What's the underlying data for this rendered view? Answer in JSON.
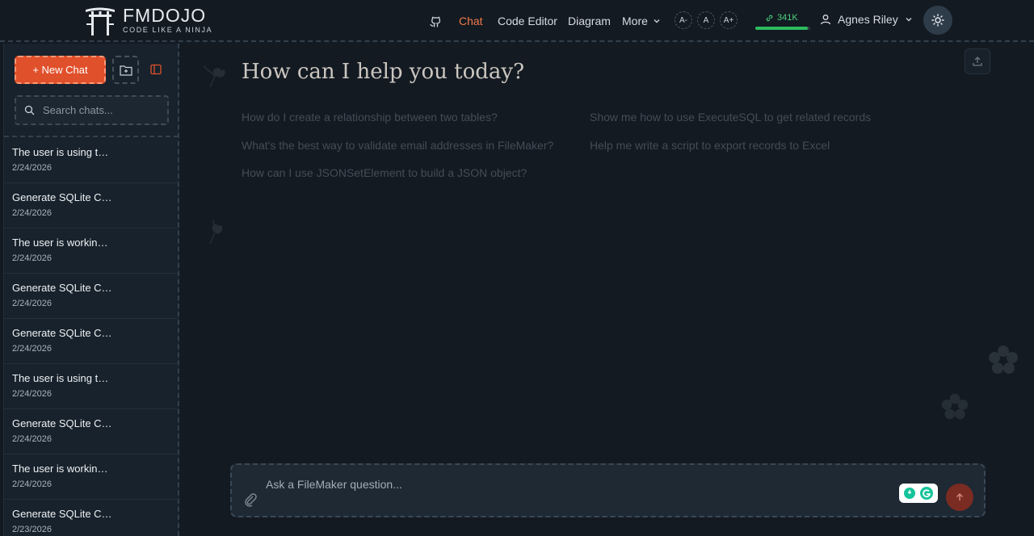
{
  "header": {
    "logo": {
      "name": "FMDOJO",
      "tagline": "CODE LIKE A NINJA",
      "icon": "torii-gate-icon"
    },
    "nav": [
      {
        "label": "Chat",
        "active": true
      },
      {
        "label": "Code Editor",
        "active": false
      },
      {
        "label": "Diagram",
        "active": false
      },
      {
        "label": "More",
        "active": false
      }
    ],
    "font_controls": [
      "A-",
      "A",
      "A+"
    ],
    "tokens": {
      "label": "341K",
      "fill_fraction": 0.95,
      "color": "#2dbb5d"
    },
    "user": {
      "name": "Agnes Riley"
    },
    "icons": {
      "github": "github-icon",
      "theme": "sun-icon"
    }
  },
  "sidebar": {
    "new_chat_label": "+ New Chat",
    "search_placeholder": "Search chats...",
    "chats": [
      {
        "title": "The user is using t…",
        "date": "2/24/2026"
      },
      {
        "title": "Generate SQLite C…",
        "date": "2/24/2026"
      },
      {
        "title": "The user is workin…",
        "date": "2/24/2026"
      },
      {
        "title": "Generate SQLite C…",
        "date": "2/24/2026"
      },
      {
        "title": "Generate SQLite C…",
        "date": "2/24/2026"
      },
      {
        "title": "The user is using t…",
        "date": "2/24/2026"
      },
      {
        "title": "Generate SQLite C…",
        "date": "2/24/2026"
      },
      {
        "title": "The user is workin…",
        "date": "2/24/2026"
      },
      {
        "title": "Generate SQLite C…",
        "date": "2/23/2026"
      }
    ]
  },
  "main": {
    "heading": "How can I help you today?",
    "suggestions": [
      "How do I create a relationship between two tables?",
      "Show me how to use ExecuteSQL to get related records",
      "What's the best way to validate email addresses in FileMaker?",
      "Help me write a script to export records to Excel",
      "How can I use JSONSetElement to build a JSON object?"
    ],
    "composer_placeholder": "Ask a FileMaker question..."
  },
  "colors": {
    "accent": "#e0502b",
    "active_nav": "#f07a4a",
    "background": "#131a22"
  }
}
